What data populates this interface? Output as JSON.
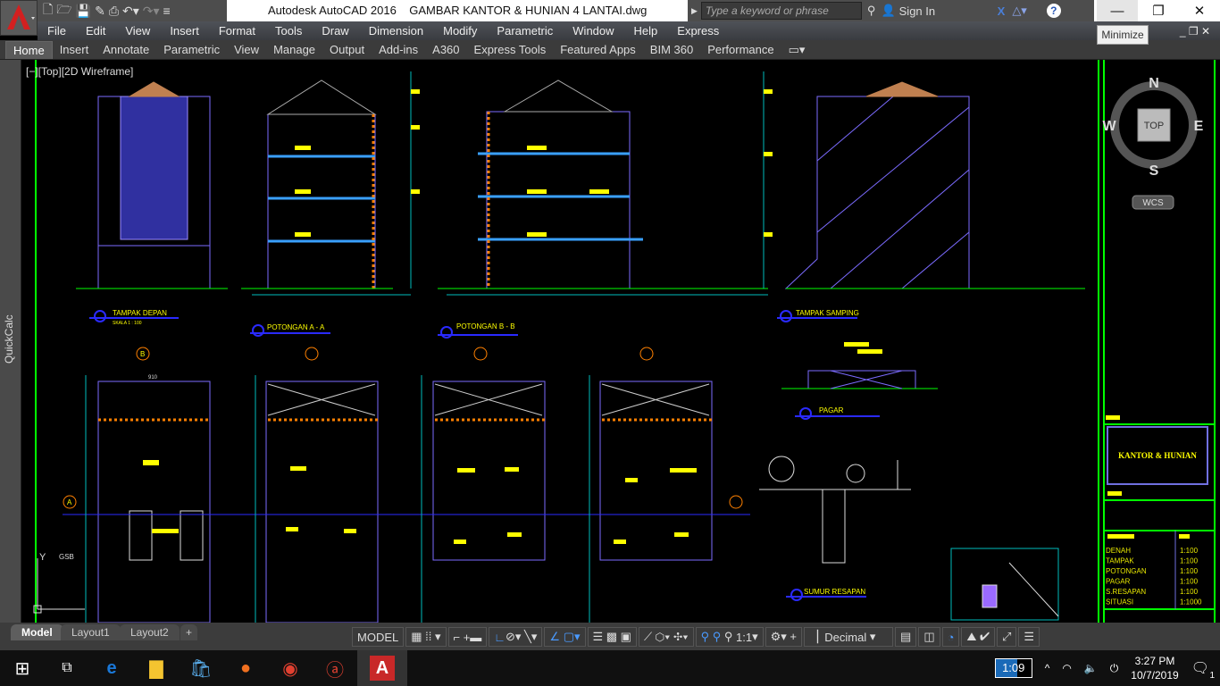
{
  "app": {
    "title": "Autodesk AutoCAD 2016    GAMBAR KANTOR & HUNIAN 4 LANTAI.dwg",
    "logo": "A"
  },
  "search": {
    "placeholder": "Type a keyword or phrase",
    "sign_in": "Sign In"
  },
  "window": {
    "minimize_tooltip": "Minimize"
  },
  "menu": [
    "File",
    "Edit",
    "View",
    "Insert",
    "Format",
    "Tools",
    "Draw",
    "Dimension",
    "Modify",
    "Parametric",
    "Window",
    "Help",
    "Express"
  ],
  "ribbon_tabs": [
    "Home",
    "Insert",
    "Annotate",
    "Parametric",
    "View",
    "Manage",
    "Output",
    "Add-ins",
    "A360",
    "Express Tools",
    "Featured Apps",
    "BIM 360",
    "Performance"
  ],
  "palette": {
    "quickcalc": "QuickCalc"
  },
  "viewport": {
    "label": "[−][Top][2D Wireframe]"
  },
  "viewcube": {
    "n": "N",
    "s": "S",
    "e": "E",
    "w": "W",
    "top": "TOP",
    "wcs": "WCS"
  },
  "drawing": {
    "labels": {
      "tampak_depan": "TAMPAK DEPAN",
      "potongan_a": "POTONGAN A - A",
      "potongan_b": "POTONGAN B - B",
      "tampak_samping": "TAMPAK SAMPING",
      "pagar": "PAGAR",
      "sumur": "SUMUR RESAPAN",
      "skala": "SKALA    1 : 100",
      "gsb": "GSB",
      "axis_a": "A",
      "axis_b": "B",
      "dim_910": "910",
      "ucs_y": "Y"
    },
    "title_block": {
      "project": "KANTOR & HUNIAN",
      "scales": [
        {
          "name": "DENAH",
          "scale": "1:100"
        },
        {
          "name": "TAMPAK",
          "scale": "1:100"
        },
        {
          "name": "POTONGAN",
          "scale": "1:100"
        },
        {
          "name": "PAGAR",
          "scale": "1:100"
        },
        {
          "name": "S.RESAPAN",
          "scale": "1:100"
        },
        {
          "name": "SITUASI",
          "scale": "1:1000"
        }
      ]
    }
  },
  "layout_tabs": [
    "Model",
    "Layout1",
    "Layout2"
  ],
  "status": {
    "model": "MODEL",
    "scale": "1:1",
    "units": "Decimal"
  },
  "taskbar": {
    "battery": "1:09",
    "time": "3:27 PM",
    "date": "10/7/2019",
    "notifications": "1"
  },
  "colors": {
    "drawing_bg": "#000000",
    "line_blue": "#6b6bff",
    "text_yellow": "#ffff00",
    "green": "#00ff00",
    "cyan": "#00bcbc"
  }
}
